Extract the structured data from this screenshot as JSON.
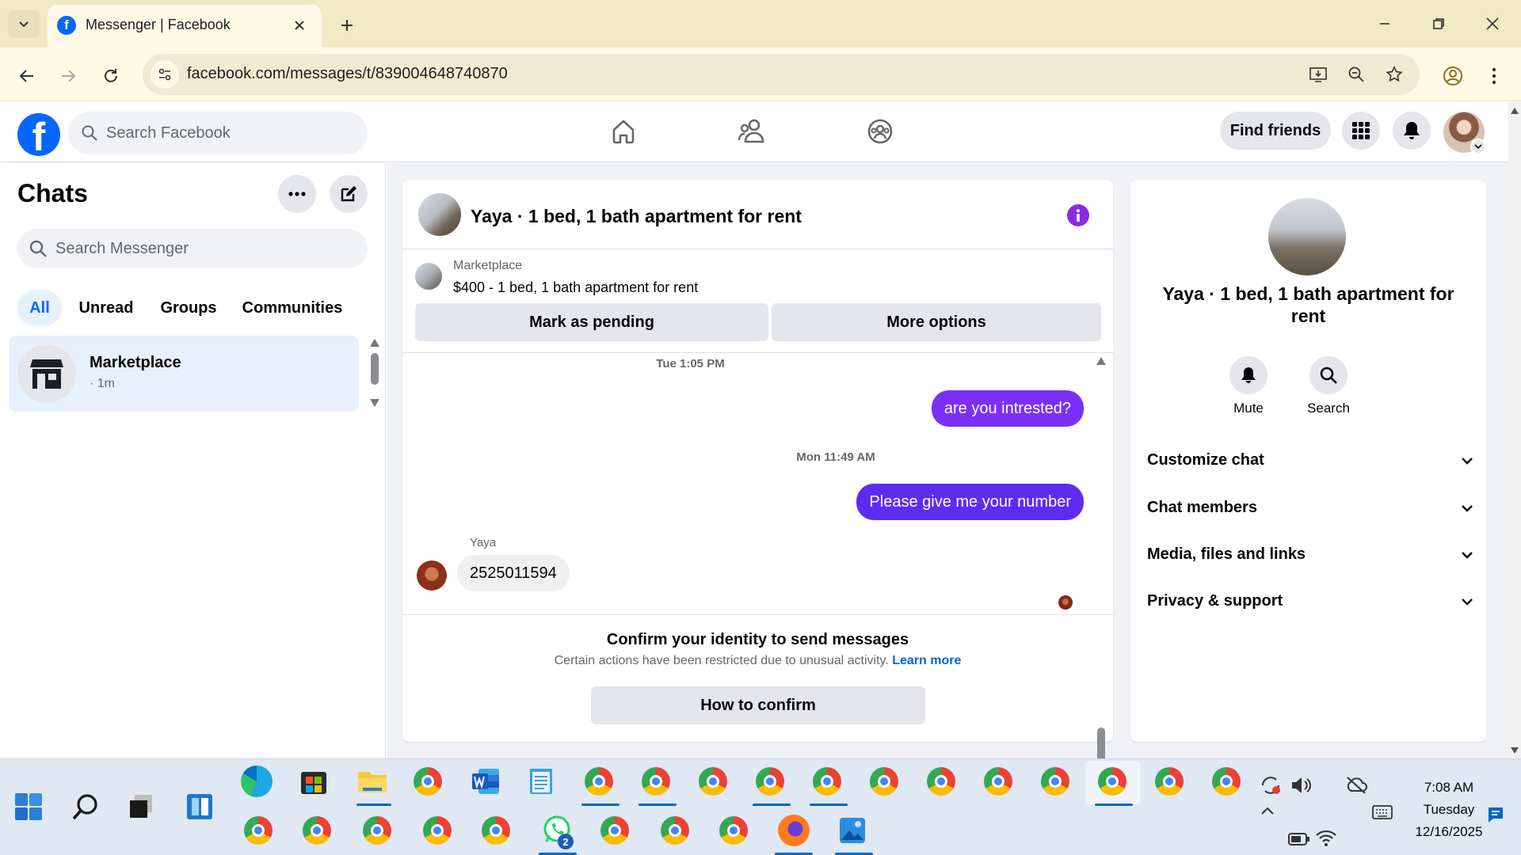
{
  "browser": {
    "tab_title": "Messenger | Facebook",
    "url": "facebook.com/messages/t/839004648740870"
  },
  "fb_header": {
    "search_placeholder": "Search Facebook",
    "find_friends_label": "Find friends"
  },
  "chats": {
    "title": "Chats",
    "search_placeholder": "Search Messenger",
    "filters": [
      "All",
      "Unread",
      "Groups",
      "Communities"
    ],
    "active_filter": "All",
    "items": [
      {
        "name": "Marketplace",
        "meta": "· 1m"
      }
    ]
  },
  "conversation": {
    "title": "Yaya · 1 bed, 1 bath apartment for rent",
    "listing": {
      "source": "Marketplace",
      "description": "$400 - 1 bed, 1 bath apartment for rent"
    },
    "mark_pending_label": "Mark as pending",
    "more_options_label": "More options",
    "messages": [
      {
        "type": "timestamp",
        "text": "Tue 1:05 PM"
      },
      {
        "type": "outgoing",
        "text": "are you intrested?"
      },
      {
        "type": "timestamp",
        "text": "Mon 11:49 AM"
      },
      {
        "type": "outgoing",
        "text": "Please give me your number"
      },
      {
        "type": "incoming",
        "sender": "Yaya",
        "text": "2525011594"
      }
    ],
    "restriction": {
      "title": "Confirm your identity to send messages",
      "text": "Certain actions have been restricted due to unusual activity.",
      "link": "Learn more",
      "button": "How to confirm"
    }
  },
  "info_panel": {
    "title": "Yaya · 1 bed, 1 bath apartment for rent",
    "actions": [
      {
        "label": "Mute",
        "icon": "bell-icon"
      },
      {
        "label": "Search",
        "icon": "search-icon"
      }
    ],
    "sections": [
      "Customize chat",
      "Chat members",
      "Media, files and links",
      "Privacy & support"
    ]
  },
  "taskbar": {
    "time": "7:08 AM",
    "day": "Tuesday",
    "date": "12/16/2025",
    "whatsapp_badge": "2"
  },
  "colors": {
    "fb_blue": "#0866ff",
    "purple": "#7b2ff7",
    "purple_blue": "#5b2df0",
    "link_blue": "#0064d1",
    "selected_chat_bg": "#e7f0fd"
  }
}
